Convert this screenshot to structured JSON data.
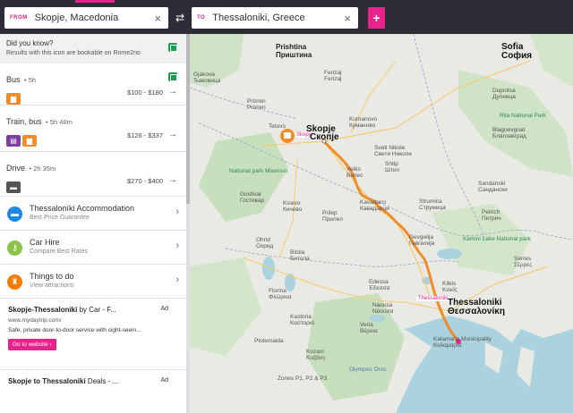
{
  "search": {
    "from_tag": "FROM",
    "from_value": "Skopje, Macedonia",
    "to_tag": "TO",
    "to_value": "Thessaloniki, Greece",
    "clear_glyph": "×",
    "swap_glyph": "⇄",
    "add_glyph": "+"
  },
  "did_you_know": {
    "title": "Did you know?",
    "text": "Results with this icon are bookable on Rome2rio"
  },
  "routes": [
    {
      "title": "Bus",
      "duration": "5h",
      "price": "$100 - $180",
      "modes": [
        "bus"
      ],
      "bookable": true
    },
    {
      "title": "Train, bus",
      "duration": "5h 48m",
      "price": "$126 - $337",
      "modes": [
        "train",
        "bus"
      ],
      "bookable": false
    },
    {
      "title": "Drive",
      "duration": "2h 35m",
      "price": "$270 - $400",
      "modes": [
        "car"
      ],
      "bookable": false
    }
  ],
  "extras": [
    {
      "title": "Thessaloníki Accommodation",
      "subtitle": "Best Price Guarantee",
      "icon": "bed-icon",
      "color": "#1e88e5"
    },
    {
      "title": "Car Hire",
      "subtitle": "Compare Best Rates",
      "icon": "key-icon",
      "color": "#8bc34a"
    },
    {
      "title": "Things to do",
      "subtitle": "View attractions",
      "icon": "landmark-icon",
      "color": "#f57c00"
    }
  ],
  "ads": [
    {
      "headline_bold": "Skopje-Thessaloniki",
      "headline_rest": " by Car - F...",
      "label": "Ad",
      "url": "www.mydaytrip.com/",
      "description": "Safe, private door-to-door service with sight-seein...",
      "button": "Go to website ›"
    },
    {
      "headline_bold": "Skopje to Thessaloniki",
      "headline_rest": " Deals - ...",
      "label": "Ad"
    }
  ],
  "map": {
    "origin_label": "Skopje",
    "destination_label": "Thessaloniki",
    "labels": [
      "Prishtina",
      "Приштина",
      "Sofia",
      "София",
      "Skopje",
      "Скопје",
      "Thessaloniki",
      "Θεσσαλονίκη",
      "Shtip",
      "Штип",
      "Strumica",
      "Струмица",
      "Gevgelija",
      "Гевгелија",
      "Kavadarci",
      "Кавадарци",
      "Prilep",
      "Прилеп",
      "Bitola",
      "Битола",
      "Ohrid",
      "Охрид",
      "Kicevo",
      "Кичево",
      "Tetovo",
      "Kumanovo",
      "Куманово",
      "Velès",
      "Велес",
      "Kastoria",
      "Καστοριά",
      "Edessa",
      "Έδεσσα",
      "Naousa",
      "Νάουσα",
      "Veria",
      "Βέροια",
      "Kozani",
      "Κοζάνη",
      "Florina",
      "Φλώρινα",
      "Kilkis",
      "Κιλκίς",
      "National park Mavrovo",
      "Rila National Park",
      "Kerkini Lake National park",
      "Olympos Oros",
      "Kalamaria Municipality",
      "Καλαμαριά",
      "Sandanski",
      "Сандански",
      "Blagoevgrad",
      "Благоевград",
      "Dupnitsa",
      "Дупница",
      "Ferizaj",
      "Ferizaj",
      "Prizren",
      "Prizren",
      "Gjakova",
      "Ђаковица",
      "Gostivar",
      "Гостивар",
      "Sveti Nikole",
      "Свети Николе",
      "Petrich",
      "Петрич",
      "Serres",
      "Σέρρες",
      "Zones P1, P2 & P3",
      "Ptolemaida"
    ]
  }
}
